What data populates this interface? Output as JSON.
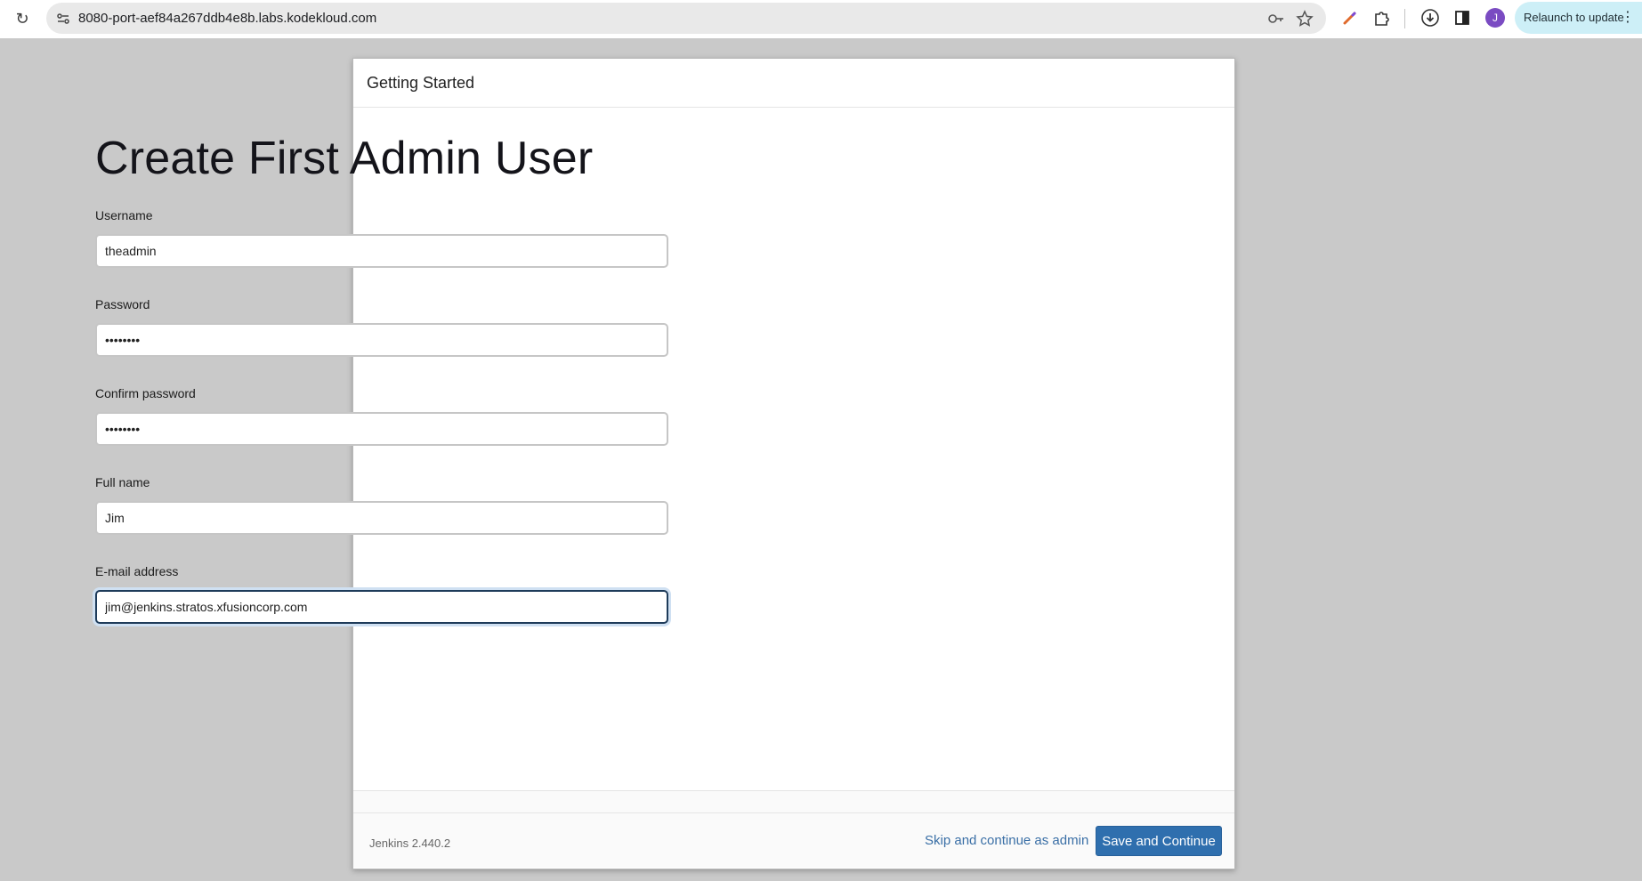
{
  "browser": {
    "url": "8080-port-aef84a267ddb4e8b.labs.kodekloud.com",
    "avatar_letter": "J",
    "relaunch_label": "Relaunch to update"
  },
  "dialog": {
    "title": "Getting Started",
    "heading": "Create First Admin User"
  },
  "form": {
    "username": {
      "label": "Username",
      "value": "theadmin"
    },
    "password": {
      "label": "Password",
      "value": "password"
    },
    "confirm_password": {
      "label": "Confirm password",
      "value": "password"
    },
    "full_name": {
      "label": "Full name",
      "value": "Jim"
    },
    "email": {
      "label": "E-mail address",
      "value": "jim@jenkins.stratos.xfusioncorp.com"
    }
  },
  "footer": {
    "version": "Jenkins 2.440.2",
    "skip_label": "Skip and continue as admin",
    "save_label": "Save and Continue"
  },
  "colors": {
    "primary_button": "#2f6fae",
    "link": "#3a6fa6",
    "focus_border": "#1e3b5a"
  }
}
